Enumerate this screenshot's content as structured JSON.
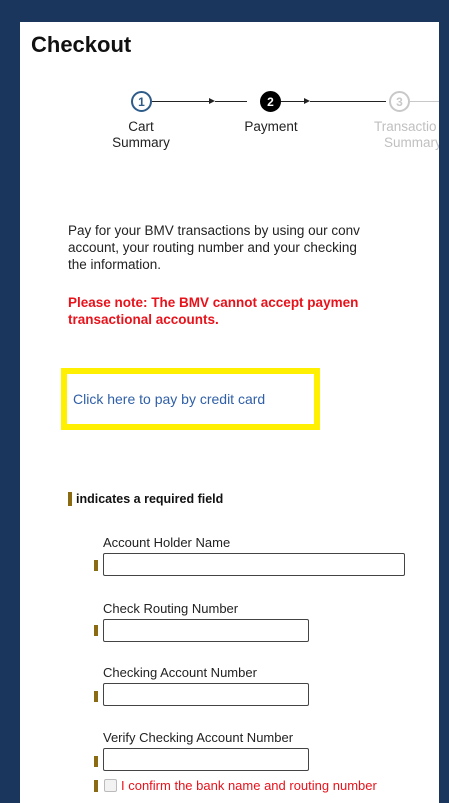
{
  "page": {
    "title": "Checkout"
  },
  "stepper": {
    "steps": [
      {
        "number": "1",
        "label_line1": "Cart",
        "label_line2": "Summary",
        "state": "done"
      },
      {
        "number": "2",
        "label_line1": "Payment",
        "label_line2": "",
        "state": "active"
      },
      {
        "number": "3",
        "label_line1": "Transactio",
        "label_line2": "Summary",
        "state": "future"
      }
    ]
  },
  "intro": {
    "line1": "Pay for your BMV transactions by using our conv",
    "line2": "account, your routing number and your checking",
    "line3": "the information."
  },
  "note": {
    "line1": "Please note: The BMV cannot accept paymen",
    "line2": "transactional accounts."
  },
  "credit_card_link": "Click here to pay by credit card",
  "required_legend": "indicates a required field",
  "fields": {
    "account_holder_name": {
      "label": "Account Holder Name",
      "value": ""
    },
    "routing_number": {
      "label": "Check Routing Number",
      "value": ""
    },
    "checking_account_number": {
      "label": "Checking Account Number",
      "value": ""
    },
    "verify_checking_account_number": {
      "label": "Verify Checking Account Number",
      "value": ""
    }
  },
  "confirm": {
    "label": "I confirm the bank name and routing number",
    "checked": false
  },
  "colors": {
    "frame": "#1b365d",
    "required_marker": "#8a6a12",
    "note_red": "#e8121b",
    "highlight_yellow": "#ffef00",
    "link_blue": "#2f5fa8"
  }
}
